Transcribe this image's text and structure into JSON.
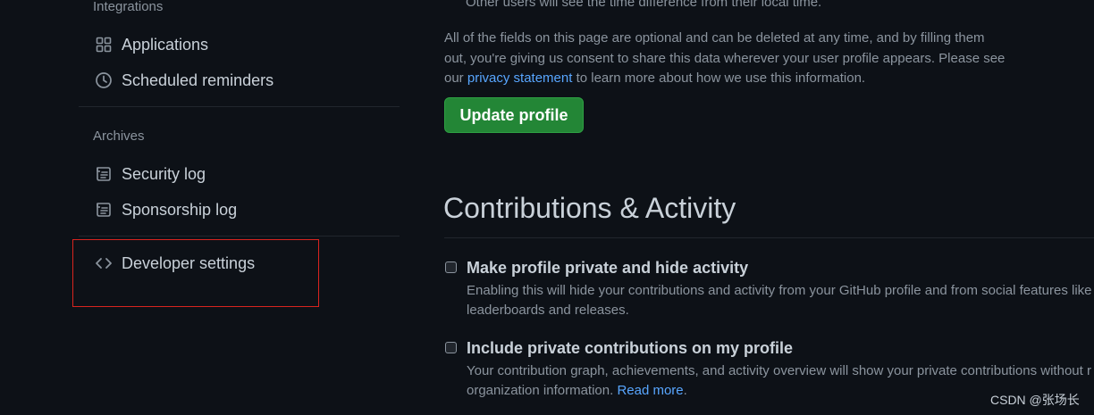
{
  "sidebar": {
    "integrations_heading": "Integrations",
    "integrations_items": [
      {
        "label": "Applications",
        "icon": "apps-grid-icon"
      },
      {
        "label": "Scheduled reminders",
        "icon": "clock-icon"
      }
    ],
    "archives_heading": "Archives",
    "archives_items": [
      {
        "label": "Security log",
        "icon": "log-icon"
      },
      {
        "label": "Sponsorship log",
        "icon": "log-icon"
      }
    ],
    "developer_settings": {
      "label": "Developer settings",
      "icon": "code-icon"
    }
  },
  "main": {
    "top_note": "Other users will see the time difference from their local time.",
    "consent": {
      "line1": "All of the fields on this page are optional and can be deleted at any time, and by filling them",
      "line2": "out, you're giving us consent to share this data wherever your user profile appears. Please see",
      "line3_prefix": "our",
      "link": "privacy statement",
      "line3_suffix": "to learn more about how we use this information."
    },
    "update_button": "Update profile",
    "contributions": {
      "title": "Contributions & Activity",
      "options": [
        {
          "title": "Make profile private and hide activity",
          "checked": false,
          "note_line1": "Enabling this will hide your contributions and activity from your GitHub profile and from social features like",
          "note_line2": "leaderboards and releases."
        },
        {
          "title": "Include private contributions on my profile",
          "checked": false,
          "note_line1": "Your contribution graph, achievements, and activity overview will show your private contributions without r",
          "note_line2_prefix": "organization information.",
          "note_link": "Read more",
          "note_line2_suffix": "."
        }
      ]
    }
  },
  "watermark": "CSDN @张场长",
  "colors": {
    "background": "#0d1117",
    "text": "#c9d1d9",
    "muted": "#8b949e",
    "link": "#58a6ff",
    "button_green": "#238636",
    "highlight_red": "#d9241f"
  }
}
